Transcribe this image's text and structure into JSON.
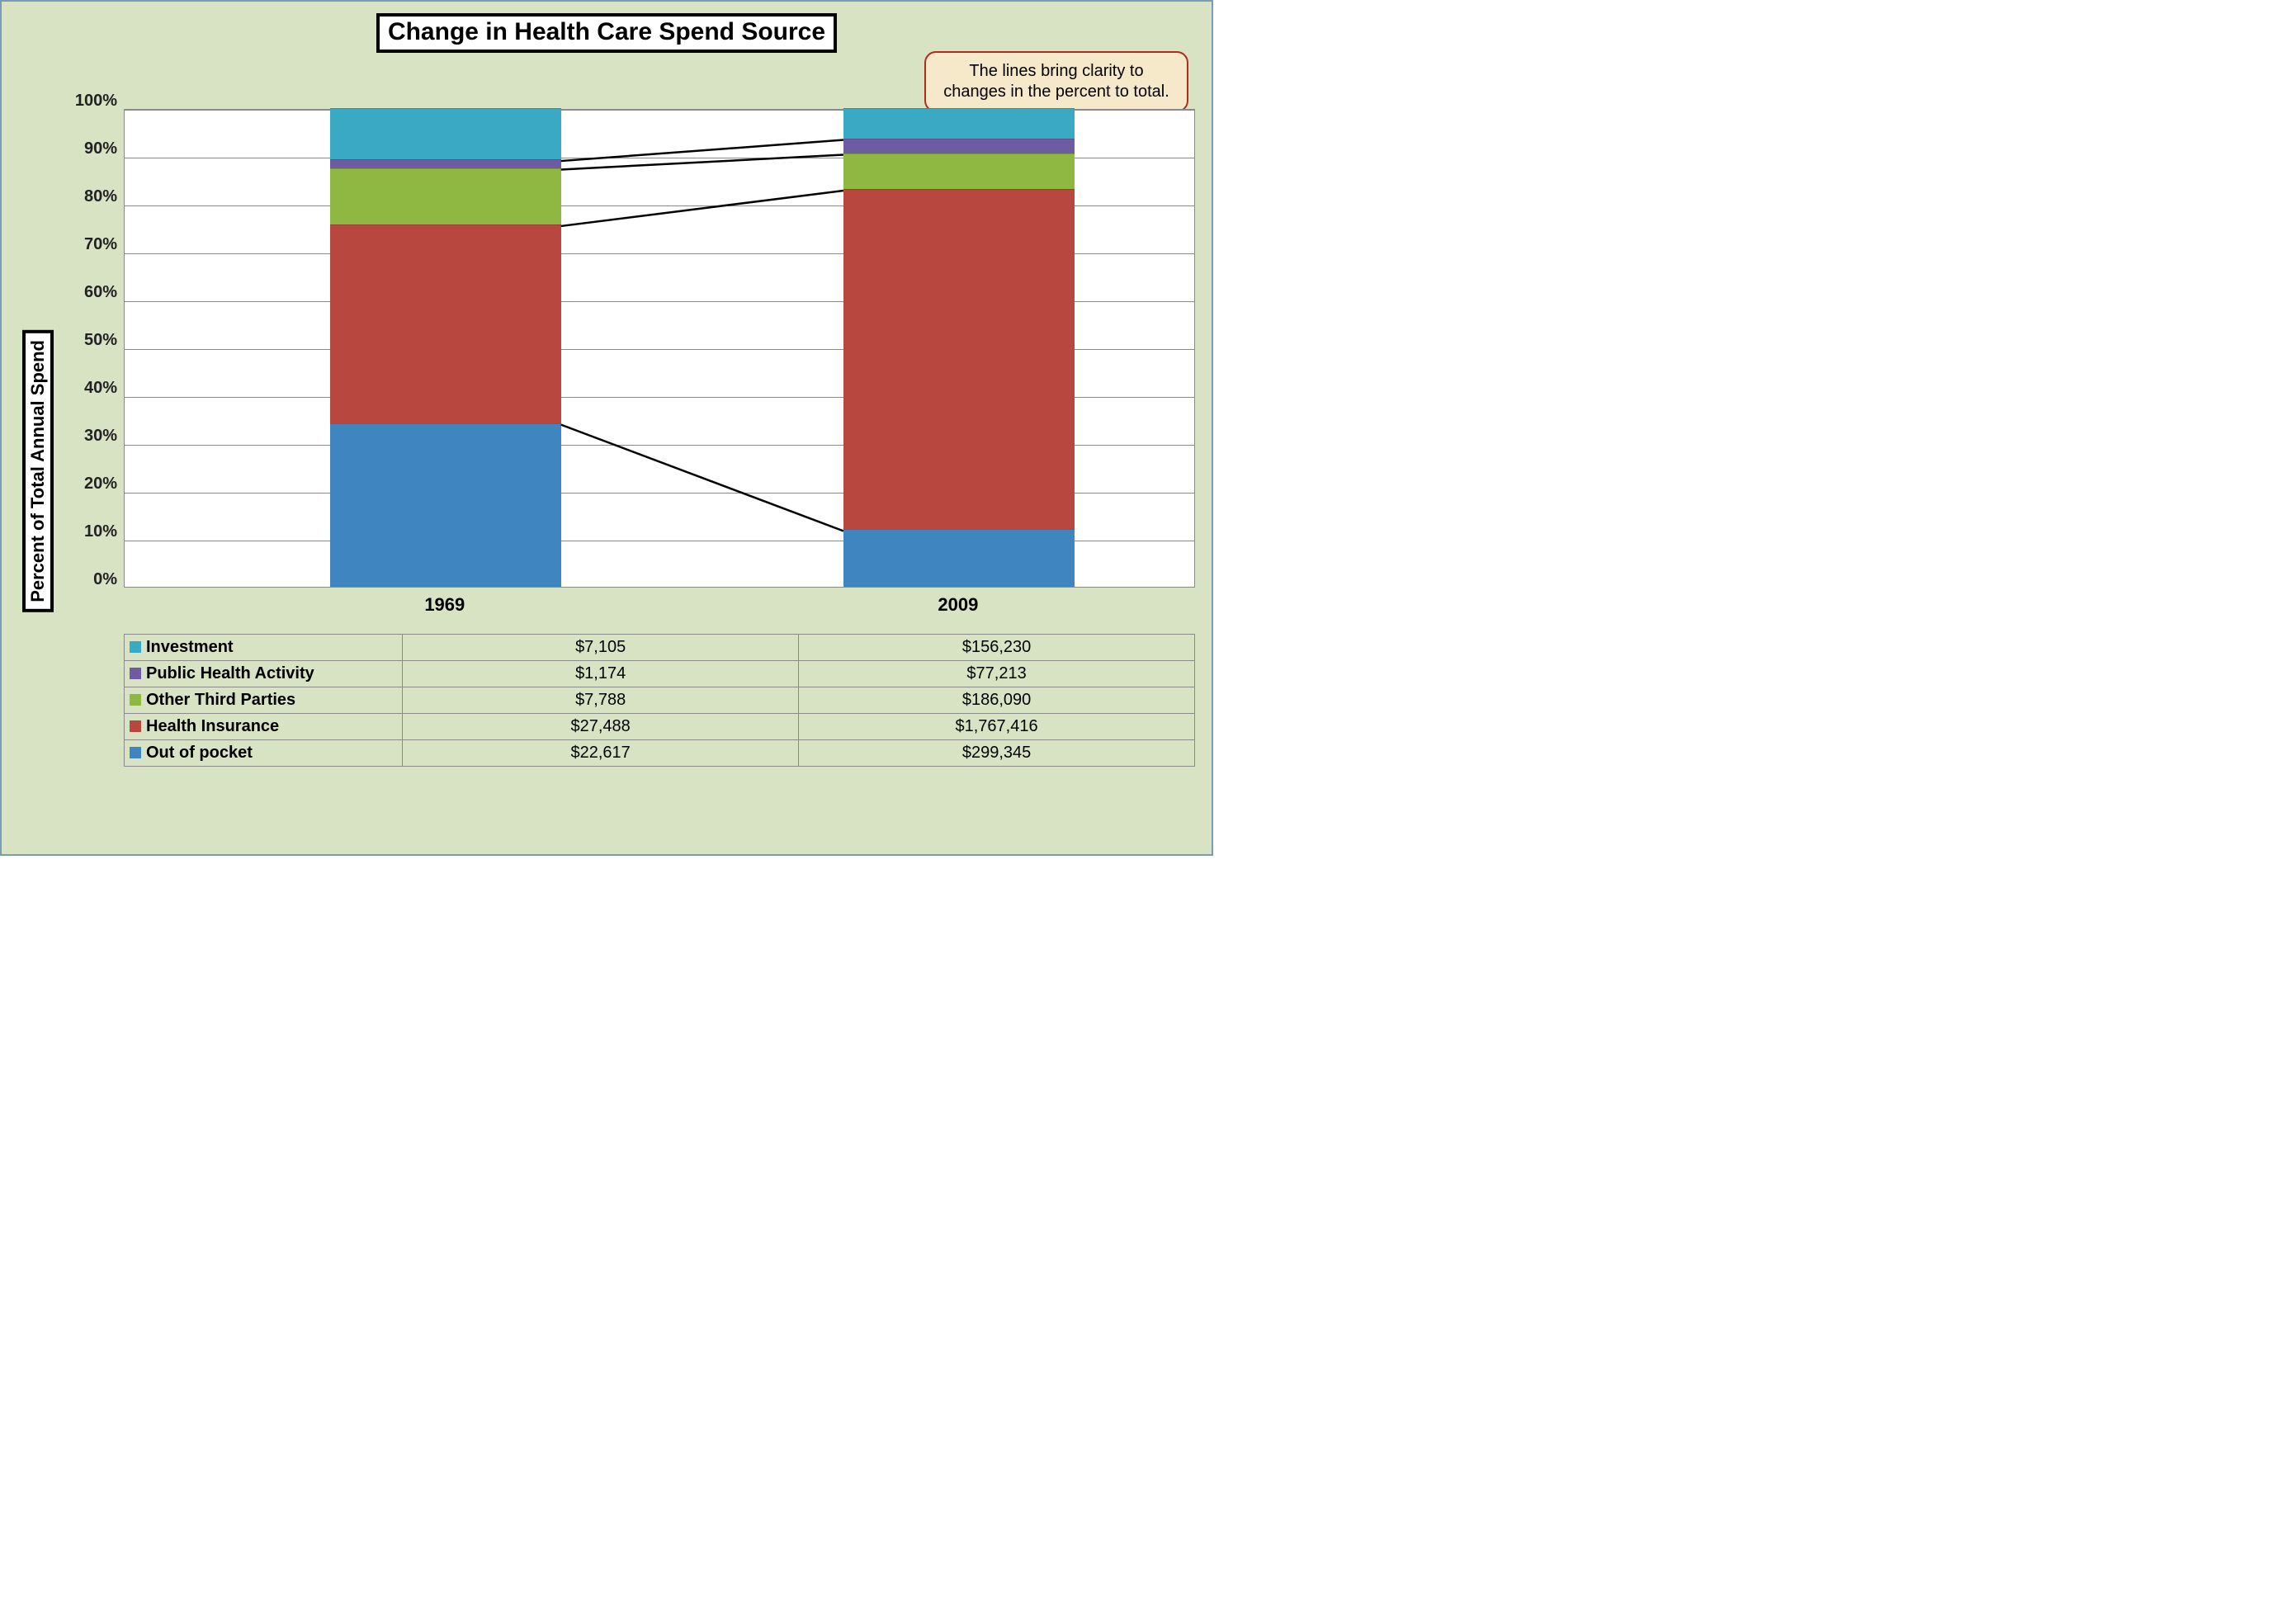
{
  "title": "Change in Health Care Spend Source",
  "ylabel": "Percent of Total Annual Spend",
  "callout": "The lines bring clarity to changes in the percent to total.",
  "y_ticks": [
    "100%",
    "90%",
    "80%",
    "70%",
    "60%",
    "50%",
    "40%",
    "30%",
    "20%",
    "10%",
    "0%"
  ],
  "categories": [
    "1969",
    "2009"
  ],
  "series_order": [
    "out_of_pocket",
    "health_insurance",
    "other_third_parties",
    "public_health_activity",
    "investment"
  ],
  "series": {
    "out_of_pocket": {
      "label": "Out of pocket",
      "color": "#3f85bf",
      "values_dollars": [
        "$22,617",
        "$299,345"
      ],
      "pct": [
        34.2,
        12.0
      ]
    },
    "health_insurance": {
      "label": "Health Insurance",
      "color": "#b7473f",
      "values_dollars": [
        "$27,488",
        "$1,767,416"
      ],
      "pct": [
        41.5,
        71.1
      ]
    },
    "other_third_parties": {
      "label": "Other Third Parties",
      "color": "#8fb842",
      "values_dollars": [
        "$7,788",
        "$186,090"
      ],
      "pct": [
        11.8,
        7.5
      ]
    },
    "public_health_activity": {
      "label": "Public Health Activity",
      "color": "#6e5ba1",
      "values_dollars": [
        "$1,174",
        "$77,213"
      ],
      "pct": [
        1.8,
        3.1
      ]
    },
    "investment": {
      "label": "Investment",
      "color": "#3aa9c4",
      "values_dollars": [
        "$7,105",
        "$156,230"
      ],
      "pct": [
        10.7,
        6.3
      ]
    }
  },
  "table_row_order": [
    "investment",
    "public_health_activity",
    "other_third_parties",
    "health_insurance",
    "out_of_pocket"
  ],
  "chart_data": {
    "type": "bar",
    "subtype": "stacked-100pct-with-connectors",
    "title": "Change in Health Care Spend Source",
    "xlabel": "",
    "ylabel": "Percent of Total Annual Spend",
    "ylim": [
      0,
      100
    ],
    "y_ticks": [
      0,
      10,
      20,
      30,
      40,
      50,
      60,
      70,
      80,
      90,
      100
    ],
    "categories": [
      "1969",
      "2009"
    ],
    "series": [
      {
        "name": "Out of pocket",
        "values_pct": [
          34.2,
          12.0
        ],
        "values_abs": [
          22617,
          299345
        ],
        "color": "#3f85bf"
      },
      {
        "name": "Health Insurance",
        "values_pct": [
          41.5,
          71.1
        ],
        "values_abs": [
          27488,
          1767416
        ],
        "color": "#b7473f"
      },
      {
        "name": "Other Third Parties",
        "values_pct": [
          11.8,
          7.5
        ],
        "values_abs": [
          7788,
          186090
        ],
        "color": "#8fb842"
      },
      {
        "name": "Public Health Activity",
        "values_pct": [
          1.8,
          3.1
        ],
        "values_abs": [
          1174,
          77213
        ],
        "color": "#6e5ba1"
      },
      {
        "name": "Investment",
        "values_pct": [
          10.7,
          6.3
        ],
        "values_abs": [
          7105,
          156230
        ],
        "color": "#3aa9c4"
      }
    ],
    "annotations": [
      {
        "text": "The lines bring clarity to changes in the percent to total.",
        "target": "connector-lines"
      }
    ]
  }
}
